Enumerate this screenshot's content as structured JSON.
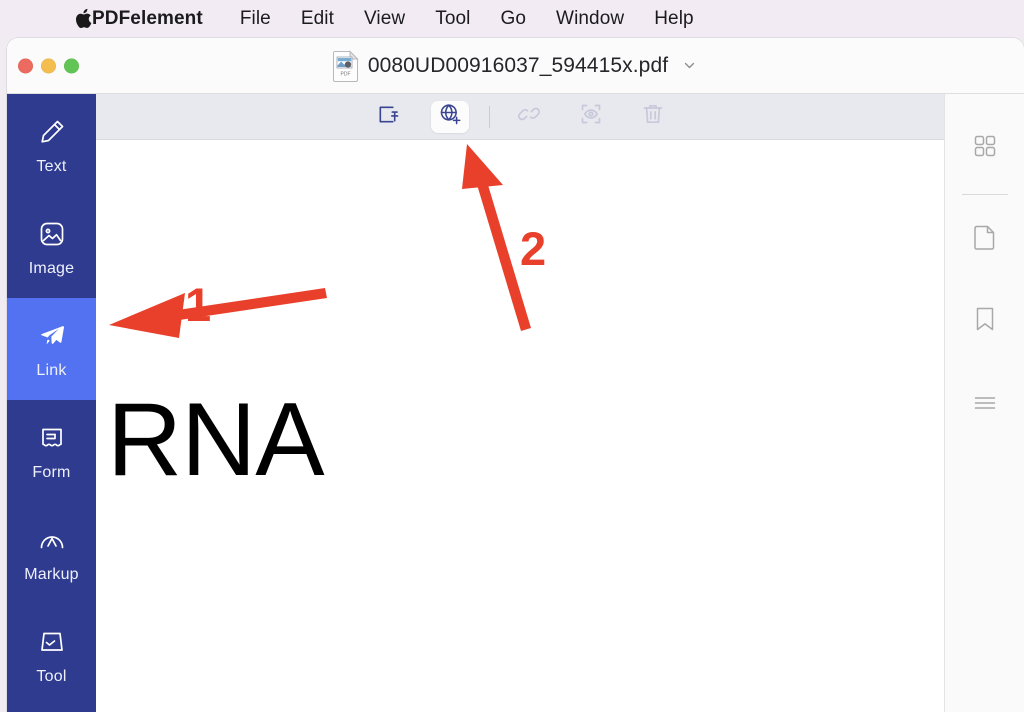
{
  "menubar": {
    "apple_icon": "apple-logo-icon",
    "items": [
      {
        "label": "PDFelement",
        "bold": true
      },
      {
        "label": "File"
      },
      {
        "label": "Edit"
      },
      {
        "label": "View"
      },
      {
        "label": "Tool"
      },
      {
        "label": "Go"
      },
      {
        "label": "Window"
      },
      {
        "label": "Help"
      }
    ]
  },
  "window": {
    "traffic_lights": [
      "close",
      "minimize",
      "zoom"
    ],
    "document_title": "0080UD00916037_594415x.pdf",
    "file_icon": "pdf-document-icon",
    "title_chevron": "chevron-down-icon"
  },
  "sidebar": {
    "items": [
      {
        "label": "Text",
        "icon": "pencil-icon",
        "active": false
      },
      {
        "label": "Image",
        "icon": "image-icon",
        "active": false
      },
      {
        "label": "Link",
        "icon": "paper-plane-icon",
        "active": true
      },
      {
        "label": "Form",
        "icon": "form-icon",
        "active": false
      },
      {
        "label": "Markup",
        "icon": "markup-arc-icon",
        "active": false
      },
      {
        "label": "Tool",
        "icon": "toolbox-icon",
        "active": false
      }
    ],
    "bg_color": "#2F3B8E",
    "active_color": "#5272F2"
  },
  "toolbar": {
    "buttons": [
      {
        "name": "add-page-link-button",
        "icon": "page-pin-icon",
        "state": "enabled"
      },
      {
        "name": "add-web-link-button",
        "icon": "globe-plus-icon",
        "state": "selected"
      },
      {
        "name": "edit-link-button",
        "icon": "broken-chain-icon",
        "state": "disabled"
      },
      {
        "name": "preview-link-button",
        "icon": "eye-focus-icon",
        "state": "disabled"
      },
      {
        "name": "delete-link-button",
        "icon": "trash-icon",
        "state": "disabled"
      }
    ],
    "bg_color": "#E7E9EE"
  },
  "page": {
    "content_text": "RNA",
    "background": "#FFFFFF"
  },
  "right_panel": {
    "buttons": [
      {
        "name": "thumbnail-grid-button",
        "icon": "grid-four-squares-icon"
      },
      {
        "name": "page-view-button",
        "icon": "document-page-icon"
      },
      {
        "name": "bookmark-button",
        "icon": "bookmark-icon"
      },
      {
        "name": "outline-button",
        "icon": "list-lines-icon"
      }
    ]
  },
  "annotations": {
    "color": "#E8402A",
    "markers": [
      {
        "label": "1",
        "description": "arrow pointing left to Link sidebar tool"
      },
      {
        "label": "2",
        "description": "arrow pointing up-left to globe add-web-link button"
      }
    ]
  }
}
